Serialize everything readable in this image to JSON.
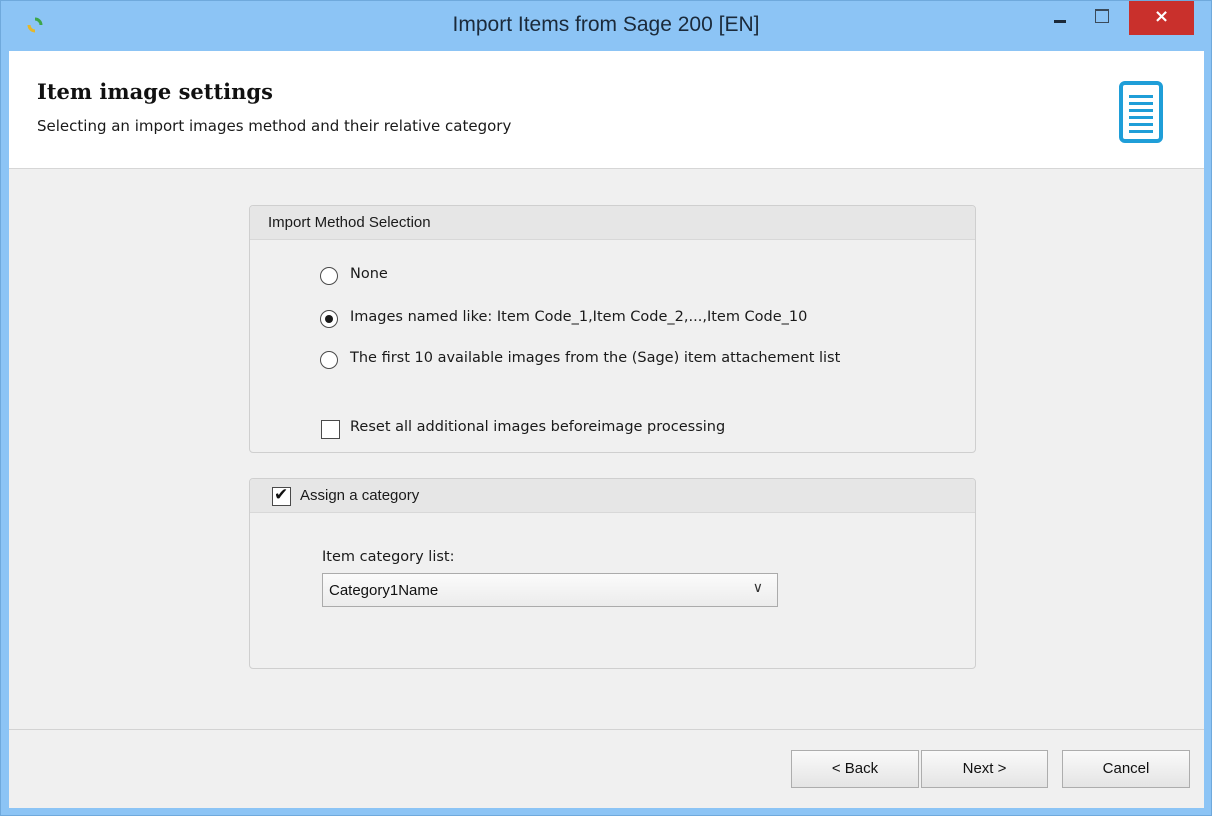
{
  "window": {
    "title": "Import Items from Sage 200 [EN]",
    "close_glyph": "×",
    "accent_color": "#8cc4f5",
    "close_color": "#c9302c"
  },
  "header": {
    "title": "Item image settings",
    "subtitle": "Selecting an import images method and their relative category",
    "icon": "document-icon"
  },
  "import_method": {
    "heading": "Import Method Selection",
    "options": [
      {
        "label": "None",
        "selected": false
      },
      {
        "label": "Images named like: Item Code_1,Item Code_2,...,Item Code_10",
        "selected": true
      },
      {
        "label": "The first 10 available images from the (Sage) item attachement list",
        "selected": false
      }
    ],
    "reset_label": "Reset all additional images beforeimage processing",
    "reset_checked": false
  },
  "category": {
    "assign_label": "Assign a category",
    "assign_checked": true,
    "list_label": "Item category list:",
    "selected_value": "Category1Name",
    "arrow_glyph": "∨"
  },
  "footer": {
    "back_label": "< Back",
    "next_label": "Next >",
    "cancel_label": "Cancel"
  }
}
